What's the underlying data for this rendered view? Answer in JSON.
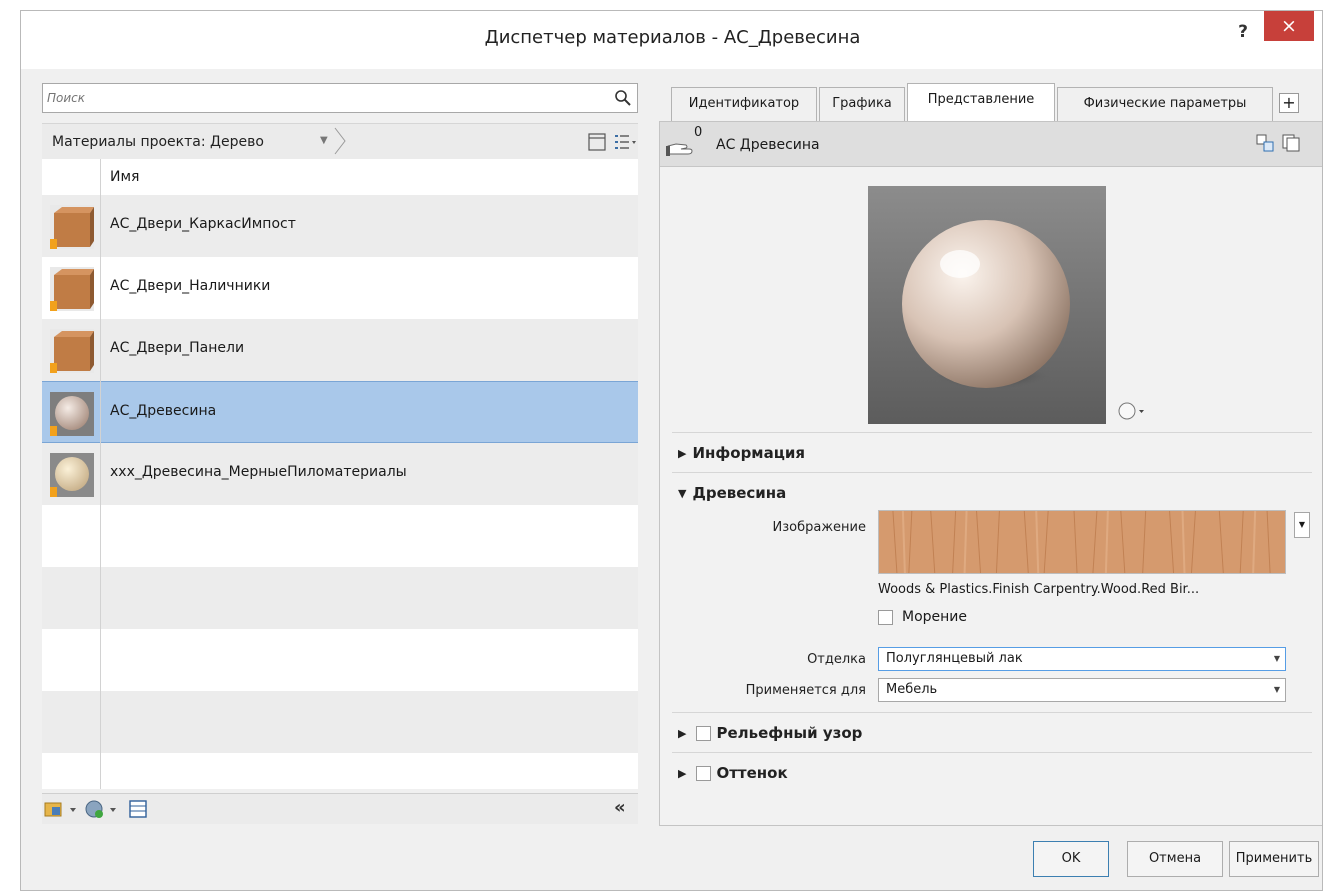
{
  "window": {
    "title": "Диспетчер материалов - АС_Древесина",
    "help_label": "?",
    "close_label": "×"
  },
  "browser": {
    "search_placeholder": "Поиск",
    "breadcrumb": "Материалы проекта: Дерево",
    "column_header": "Имя",
    "materials": [
      {
        "name": "АС_Двери_КаркасИмпост",
        "thumb": "box-orange"
      },
      {
        "name": "АС_Двери_Наличники",
        "thumb": "box-orange"
      },
      {
        "name": "АС_Двери_Панели",
        "thumb": "box-orange"
      },
      {
        "name": "АС_Древесина",
        "thumb": "sphere-light",
        "selected": true
      },
      {
        "name": "xxx_Древесина_МерныеПиломатериалы",
        "thumb": "sphere-cream"
      }
    ],
    "collapse_label": "«"
  },
  "tabs": [
    "Идентификатор",
    "Графика",
    "Представление",
    "Физические параметры"
  ],
  "active_tab": "Представление",
  "tab_add_label": "+",
  "asset": {
    "count": "0",
    "name": "АС Древесина"
  },
  "sections": {
    "information": "Информация",
    "wood": "Древесина",
    "relief": "Рельефный узор",
    "tint": "Оттенок"
  },
  "wood_params": {
    "image_label": "Изображение",
    "image_name": "Woods & Plastics.Finish Carpentry.Wood.Red Bir...",
    "stain_label": "Морение",
    "finish_label": "Отделка",
    "finish_value": "Полуглянцевый лак",
    "used_for_label": "Применяется для",
    "used_for_value": "Мебель"
  },
  "buttons": {
    "ok": "OK",
    "cancel": "Отмена",
    "apply": "Применить"
  },
  "colors": {
    "selection": "#a9c8ea",
    "close": "#c7403a",
    "wood_grain": "#d59a6e"
  }
}
